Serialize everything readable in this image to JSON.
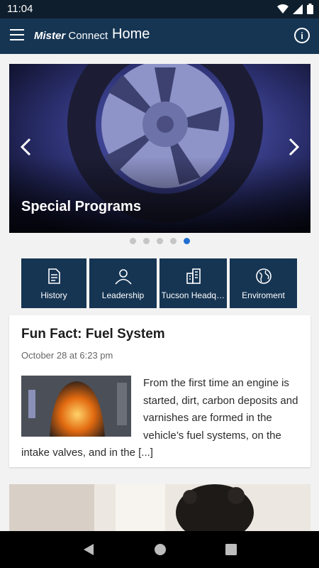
{
  "status_bar": {
    "time": "11:04"
  },
  "app_bar": {
    "brand_mister": "Mister",
    "brand_connect": "Connect",
    "title": "Home",
    "info_label": "i"
  },
  "carousel": {
    "caption": "Special Programs",
    "slide_count": 5,
    "active_index": 4
  },
  "quick_links": [
    {
      "label": "History",
      "icon": "document-icon"
    },
    {
      "label": "Leadership",
      "icon": "person-icon"
    },
    {
      "label": "Tucson Headquarters",
      "icon": "building-icon"
    },
    {
      "label": "Enviroment",
      "icon": "globe-icon"
    }
  ],
  "post": {
    "title": "Fun Fact: Fuel System",
    "date": "October 28 at 6:23 pm",
    "excerpt": "From the first time an engine is started, dirt, carbon deposits and varnishes are formed in the vehicle’s fuel systems, on the intake valves, and in the [...]"
  },
  "colors": {
    "status_bar": "#0f1e2c",
    "app_bar": "#163553",
    "quick_link_bg": "#163553",
    "active_dot": "#1f6fd1"
  }
}
